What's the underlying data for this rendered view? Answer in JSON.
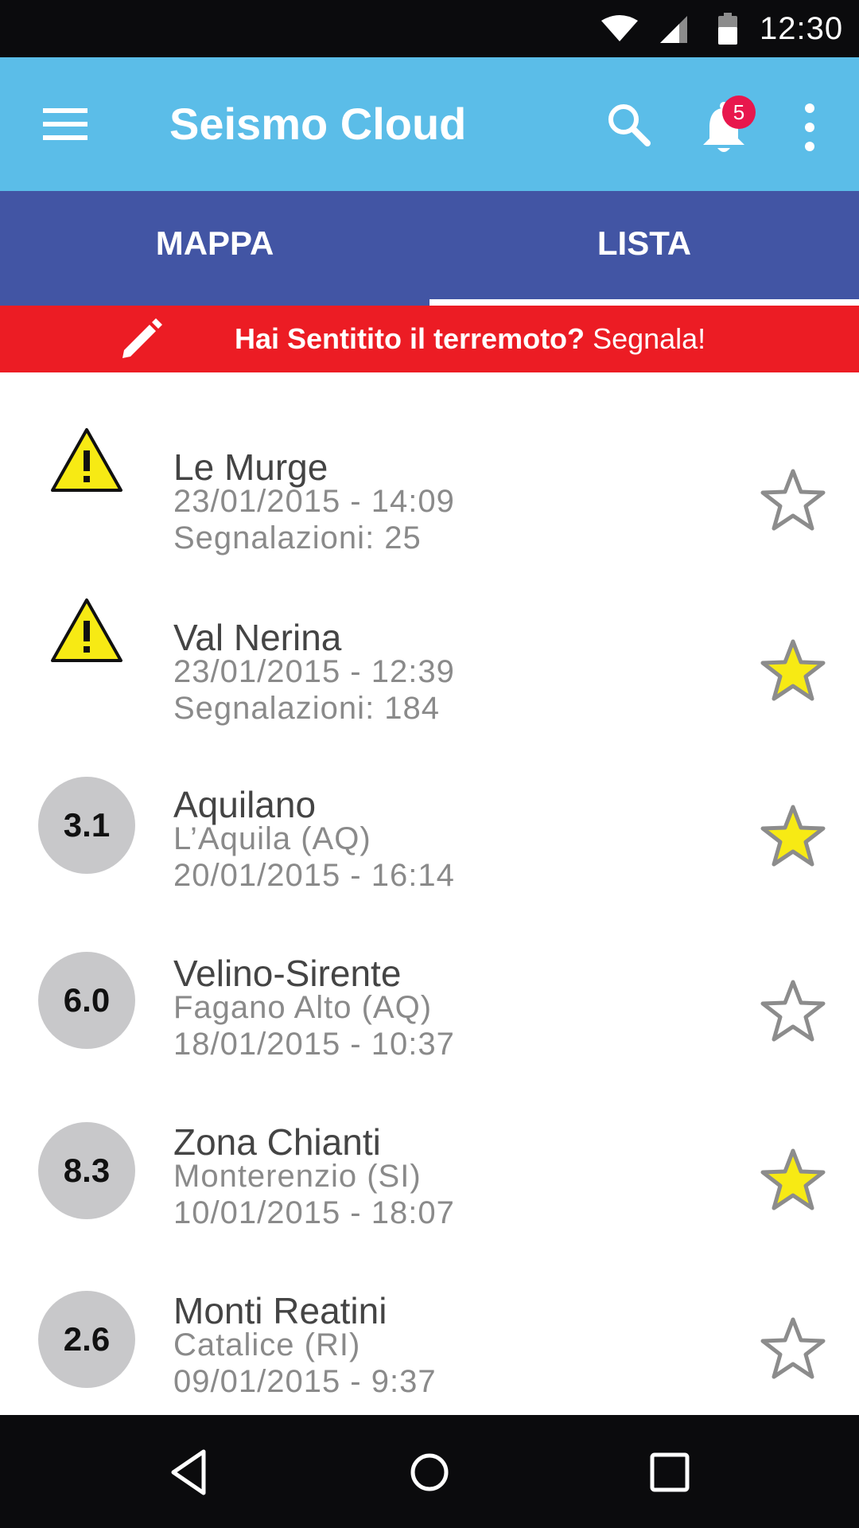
{
  "status_bar": {
    "time": "12:30",
    "icons": [
      "wifi-icon",
      "signal-icon",
      "battery-icon"
    ]
  },
  "app_bar": {
    "title": "Seismo Cloud",
    "notification_count": "5",
    "icons": [
      "menu-icon",
      "search-icon",
      "bell-icon",
      "more-vertical-icon"
    ]
  },
  "tabs": [
    {
      "label": "MAPPA",
      "selected": false
    },
    {
      "label": "LISTA",
      "selected": true
    }
  ],
  "report_banner": {
    "bold_text": "Hai Sentitito il terremoto?",
    "action_text": "Segnala!",
    "icon": "pencil-icon",
    "background": "#ec1c24"
  },
  "events": [
    {
      "indicator": "warning",
      "magnitude": "",
      "title": "Le Murge",
      "line2": "23/01/2015 - 14:09",
      "line3": "Segnalazioni: 25",
      "favorite": false
    },
    {
      "indicator": "warning",
      "magnitude": "",
      "title": "Val Nerina",
      "line2": "23/01/2015 - 12:39",
      "line3": "Segnalazioni: 184",
      "favorite": true
    },
    {
      "indicator": "magnitude",
      "magnitude": "3.1",
      "title": "Aquilano",
      "line2": "L’Aquila (AQ)",
      "line3": "20/01/2015 - 16:14",
      "favorite": true
    },
    {
      "indicator": "magnitude",
      "magnitude": "6.0",
      "title": "Velino-Sirente",
      "line2": "Fagano Alto (AQ)",
      "line3": "18/01/2015 -  10:37",
      "favorite": false
    },
    {
      "indicator": "magnitude",
      "magnitude": "8.3",
      "title": "Zona Chianti",
      "line2": "Monterenzio (SI)",
      "line3": "10/01/2015 - 18:07",
      "favorite": true
    },
    {
      "indicator": "magnitude",
      "magnitude": "2.6",
      "title": "Monti Reatini",
      "line2": "Catalice (RI)",
      "line3": "09/01/2015 - 9:37",
      "favorite": false
    }
  ],
  "colors": {
    "app_bar": "#5bbde8",
    "tab_bar": "#4255a4",
    "badge": "#e8174d",
    "star_fill": "#f7ea14",
    "warning_fill": "#f7ea14"
  },
  "nav_bar": {
    "icons": [
      "back-icon",
      "home-icon",
      "recents-icon"
    ]
  }
}
